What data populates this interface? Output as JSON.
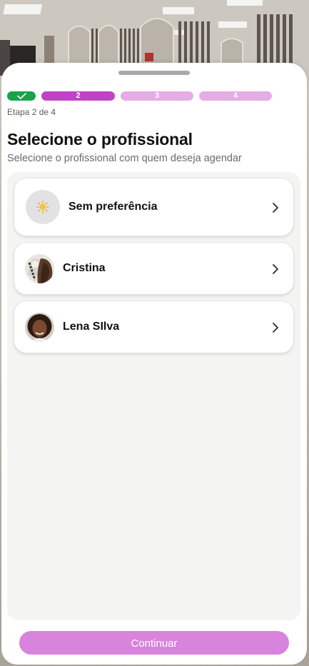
{
  "background": {
    "image": "salon-interior-photo"
  },
  "steps": {
    "items": [
      {
        "label": "",
        "state": "done",
        "icon": "check-icon"
      },
      {
        "label": "2",
        "state": "current"
      },
      {
        "label": "3",
        "state": "upcoming"
      },
      {
        "label": "4",
        "state": "upcoming"
      }
    ],
    "caption": "Etapa 2 de 4"
  },
  "header": {
    "title": "Selecione o profissional",
    "subtitle": "Selecione o profissional com quem deseja agendar"
  },
  "professionals": [
    {
      "name": "Sem preferência",
      "icon": "sparkle-icon"
    },
    {
      "name": "Cristina",
      "avatar": "cristina-photo"
    },
    {
      "name": "Lena SIlva",
      "avatar": "lena-photo"
    }
  ],
  "footer": {
    "continue_label": "Continuar"
  },
  "colors": {
    "done": "#1aa34a",
    "current": "#c043c7",
    "upcoming": "#e4ade6",
    "button": "#d883dc"
  }
}
